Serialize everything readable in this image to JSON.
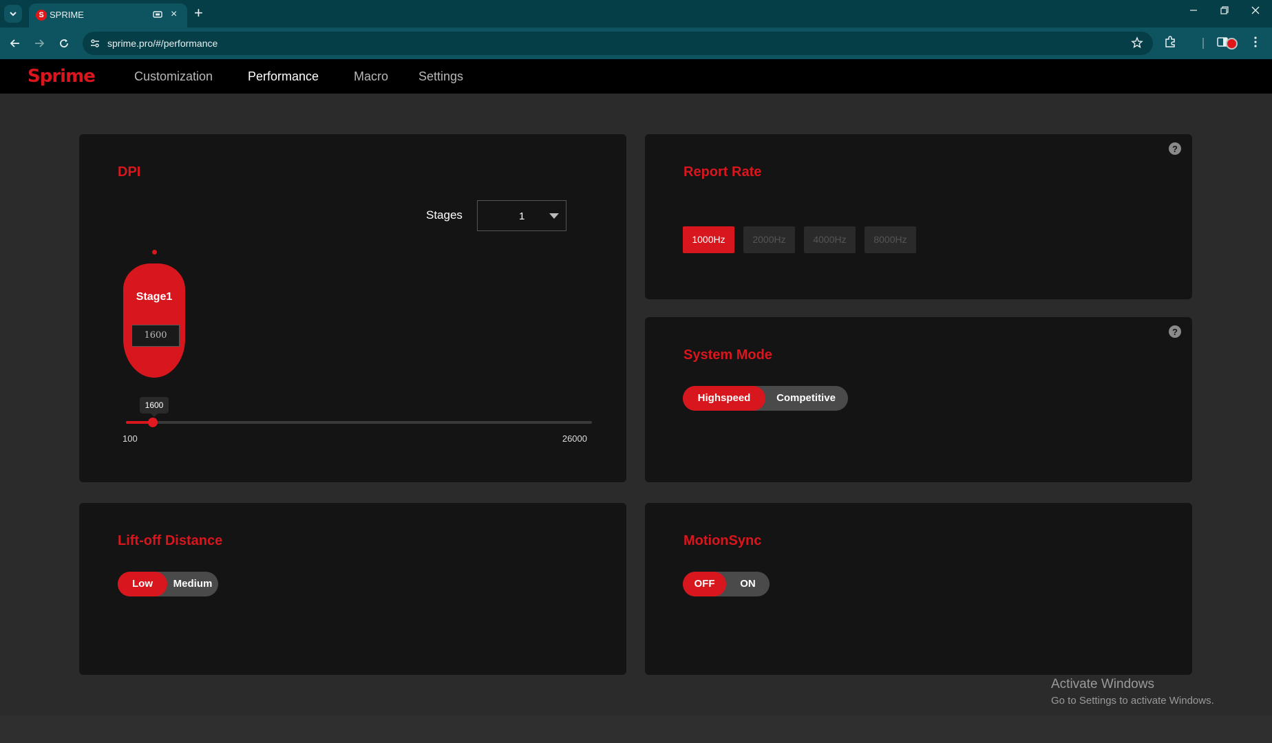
{
  "browser": {
    "tab_title": "SPRIME",
    "tab_favicon_letter": "S",
    "url": "sprime.pro/#/performance"
  },
  "app": {
    "logo": "Sprime",
    "nav": [
      {
        "label": "Customization",
        "active": false
      },
      {
        "label": "Performance",
        "active": true
      },
      {
        "label": "Macro",
        "active": false
      },
      {
        "label": "Settings",
        "active": false
      }
    ],
    "accent_color": "#d8161d"
  },
  "dpi": {
    "title": "DPI",
    "stages_label": "Stages",
    "stages_value": "1",
    "stage_name": "Stage1",
    "stage_value": "1600",
    "slider_value": "1600",
    "slider_min": "100",
    "slider_max": "26000"
  },
  "report_rate": {
    "title": "Report Rate",
    "options": [
      "1000Hz",
      "2000Hz",
      "4000Hz",
      "8000Hz"
    ],
    "selected": "1000Hz"
  },
  "system_mode": {
    "title": "System Mode",
    "options": [
      "Highspeed",
      "Competitive"
    ],
    "selected": "Highspeed"
  },
  "liftoff": {
    "title": "Lift-off Distance",
    "options": [
      "Low",
      "Medium"
    ],
    "selected": "Low"
  },
  "motionsync": {
    "title": "MotionSync",
    "options": [
      "OFF",
      "ON"
    ],
    "selected": "OFF"
  },
  "watermark": {
    "line1": "Activate Windows",
    "line2": "Go to Settings to activate Windows."
  }
}
